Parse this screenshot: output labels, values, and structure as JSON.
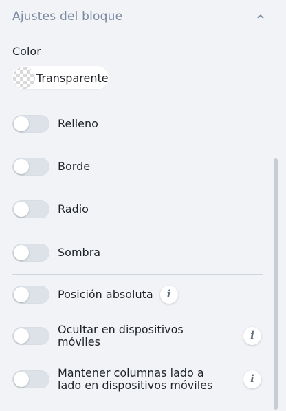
{
  "colors": {
    "background": "#f1f3f7",
    "headerText": "#7a8aa0",
    "text": "#1f2328",
    "toggleTrack": "#dde2e8",
    "knob": "#ffffff",
    "infoIcon": "#5c6b7a",
    "divider": "#cfd6df",
    "scrollbar": "#c7cdd5"
  },
  "section": {
    "title": "Ajustes del bloque",
    "collapse_icon": "chevron-up-icon"
  },
  "color": {
    "label": "Color",
    "value": "Transparente"
  },
  "toggles": [
    {
      "label": "Relleno",
      "on": false,
      "info": false
    },
    {
      "label": "Borde",
      "on": false,
      "info": false
    },
    {
      "label": "Radio",
      "on": false,
      "info": false
    },
    {
      "label": "Sombra",
      "on": false,
      "info": false
    },
    {
      "label": "Posición absoluta",
      "on": false,
      "info": true
    },
    {
      "label": "Ocultar en dispositivos móviles",
      "on": false,
      "info": true
    },
    {
      "label": "Mantener columnas lado a lado en dispositivos móviles",
      "on": false,
      "info": true
    }
  ],
  "info_icon_glyph": "i"
}
